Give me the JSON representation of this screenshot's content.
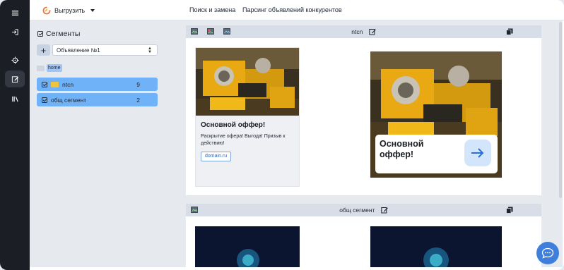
{
  "topbar": {
    "upload_label": "Выгрузить",
    "nav": [
      "Поиск и замена",
      "Парсинг объявлений конкурентов"
    ]
  },
  "rail": {
    "items": [
      "menu-icon",
      "login-icon",
      "target-icon",
      "edit-icon",
      "library-icon"
    ],
    "active_index": 3
  },
  "sidebar": {
    "title": "Сегменты",
    "add_label": "+",
    "select_value": "Объявление №1",
    "home_label": "home",
    "segments": [
      {
        "label": "ntcn",
        "count": "9"
      },
      {
        "label": "общ сегмент",
        "count": "2"
      }
    ]
  },
  "cards": [
    {
      "title": "ntcn",
      "ad_small": {
        "title": "Основной оффер!",
        "text": "Раскрытие офера! Выгода! Призыв к действию!",
        "link": "domain.ru"
      },
      "ad_big": {
        "title": "Основной оффер!"
      }
    },
    {
      "title": "общ сегмент"
    }
  ],
  "colors": {
    "rail_bg": "#1b1e25",
    "segment_selected": "#6fb2f7",
    "chat_button": "#3f7fdc"
  }
}
